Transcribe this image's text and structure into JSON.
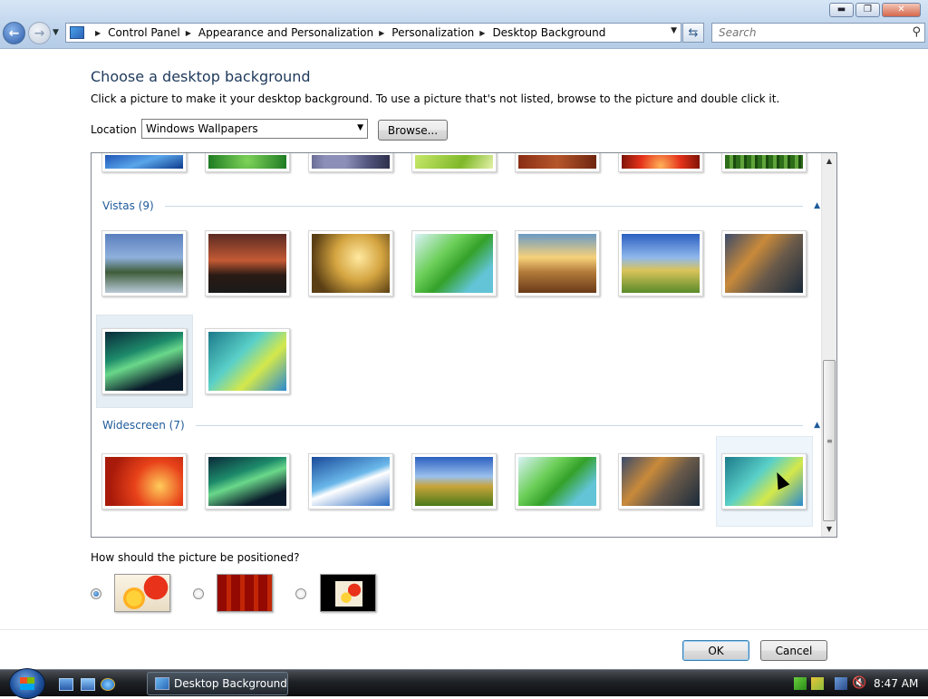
{
  "window": {
    "minimize_icon": "minimize-icon",
    "maximize_icon": "maximize-icon",
    "close_icon": "close-icon"
  },
  "address_bar": {
    "breadcrumbs": [
      "Control Panel",
      "Appearance and Personalization",
      "Personalization",
      "Desktop Background"
    ]
  },
  "search": {
    "placeholder": "Search"
  },
  "page": {
    "title": "Choose a desktop background",
    "instructions": "Click a picture to make it your desktop background. To use a picture that's not listed, browse to the picture and double click it.",
    "location_label": "Location",
    "location_value": "Windows Wallpapers",
    "browse_label": "Browse..."
  },
  "gallery": {
    "groups": [
      {
        "label": "Vistas (9)",
        "count": 9
      },
      {
        "label": "Widescreen (7)",
        "count": 7
      }
    ],
    "selected_item": "Widescreen wallpaper 7"
  },
  "position": {
    "question": "How should the picture be positioned?",
    "options": [
      "Fit to screen",
      "Tile",
      "Center"
    ],
    "selected": "Fit to screen"
  },
  "buttons": {
    "ok": "OK",
    "cancel": "Cancel"
  },
  "taskbar": {
    "active_window": "Desktop Background",
    "clock": "8:47 AM"
  },
  "colors": {
    "heading": "#1e395b",
    "group_label": "#1e5a9a",
    "titlebar": "#c4d8ee"
  }
}
